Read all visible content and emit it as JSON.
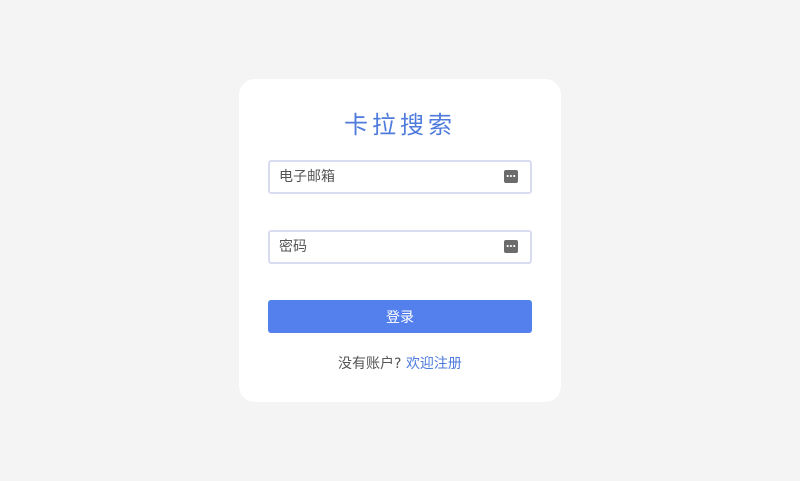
{
  "login": {
    "title": "卡拉搜索",
    "email_placeholder": "电子邮箱",
    "email_icon": "password-manager-icon",
    "password_placeholder": "密码",
    "password_icon": "password-manager-icon",
    "submit_label": "登录",
    "no_account_text": "没有账户?",
    "register_link": "欢迎注册"
  },
  "colors": {
    "accent": "#5480ee",
    "title": "#4e7bdc",
    "background": "#f4f4f4",
    "card": "#ffffff"
  }
}
